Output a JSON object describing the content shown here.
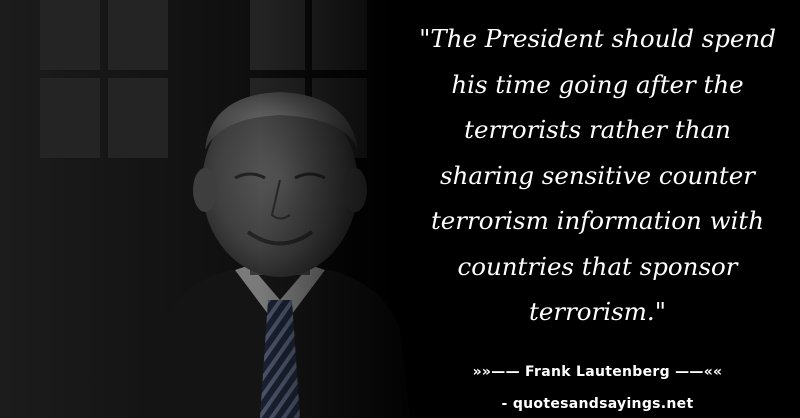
{
  "quote": {
    "text": "\"The President should spend\nhis time going after the\nterrorists rather than\nsharing sensitive counter\nterrorism information with\ncountries that sponsor\nterrorism.\""
  },
  "author": {
    "text": "»»—— Frank Lautenberg ——««"
  },
  "source": {
    "text": "- quotesandsayings.net"
  },
  "colors": {
    "background": "#000000",
    "text": "#ffffff"
  }
}
